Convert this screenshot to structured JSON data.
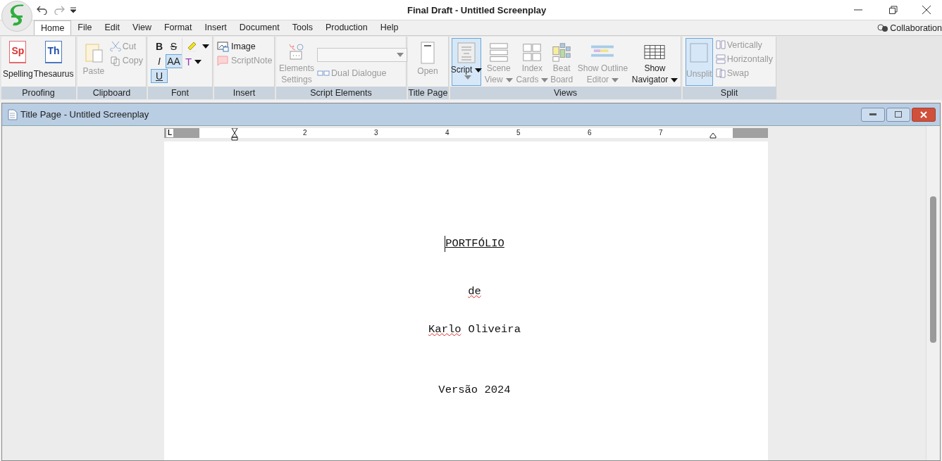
{
  "app": {
    "title": "Final Draft - Untitled Screenplay"
  },
  "menu": [
    {
      "label": "Home",
      "selected": true
    },
    {
      "label": "File",
      "selected": false
    },
    {
      "label": "Edit",
      "selected": false
    },
    {
      "label": "View",
      "selected": false
    },
    {
      "label": "Format",
      "selected": false
    },
    {
      "label": "Insert",
      "selected": false
    },
    {
      "label": "Document",
      "selected": false
    },
    {
      "label": "Tools",
      "selected": false
    },
    {
      "label": "Production",
      "selected": false
    },
    {
      "label": "Help",
      "selected": false
    }
  ],
  "collaboration": "Collaboration",
  "ribbon": [
    {
      "label": "Proofing",
      "items": [
        {
          "lines": [
            "Spelling"
          ],
          "badge": "Sp",
          "disabled": false
        },
        {
          "lines": [
            "Thesaurus"
          ],
          "badge": "Th",
          "disabled": false
        }
      ]
    },
    {
      "label": "Clipboard",
      "items": [
        {
          "lines": [
            "Paste"
          ],
          "disabled": true
        },
        {
          "lines": [
            "Cut"
          ],
          "disabled": true
        },
        {
          "lines": [
            "Copy"
          ],
          "disabled": true
        }
      ]
    },
    {
      "label": "Font",
      "items": [
        {
          "kind": "toggle",
          "label": "B",
          "selected": false
        },
        {
          "kind": "toggle",
          "label": "S",
          "selected": false
        },
        {
          "kind": "toggle",
          "label": "I",
          "selected": false
        },
        {
          "kind": "toggle",
          "label": "AA",
          "selected": true
        },
        {
          "kind": "toggle",
          "label": "U",
          "selected": true
        },
        {
          "kind": "highlight"
        },
        {
          "kind": "color",
          "label": "T"
        }
      ]
    },
    {
      "label": "Insert",
      "items": [
        {
          "lines": [
            "Image"
          ],
          "disabled": false
        },
        {
          "lines": [
            "ScriptNote"
          ],
          "disabled": true
        }
      ]
    },
    {
      "label": "Script Elements",
      "items": [
        {
          "lines": [
            "Elements",
            "Settings"
          ],
          "disabled": true
        },
        {
          "lines": [
            "Dual Dialogue"
          ],
          "disabled": true
        }
      ]
    },
    {
      "label": "Title Page",
      "items": [
        {
          "lines": [
            "Open"
          ],
          "disabled": true
        }
      ]
    },
    {
      "label": "Views",
      "items": [
        {
          "lines": [
            "Script"
          ],
          "dropdown": true,
          "selected": true,
          "disabled": false
        },
        {
          "lines": [
            "Scene",
            "View"
          ],
          "dropdown": true,
          "selected": false,
          "disabled": true
        },
        {
          "lines": [
            "Index",
            "Cards"
          ],
          "dropdown": true,
          "selected": false,
          "disabled": true
        },
        {
          "lines": [
            "Beat",
            "Board"
          ],
          "dropdown": false,
          "selected": false,
          "disabled": true
        },
        {
          "lines": [
            "Show Outline",
            "Editor"
          ],
          "dropdown": true,
          "selected": false,
          "disabled": true
        },
        {
          "lines": [
            "Show",
            "Navigator"
          ],
          "dropdown": true,
          "selected": false,
          "disabled": false
        }
      ]
    },
    {
      "label": "Split",
      "items": [
        {
          "lines": [
            "Unsplit"
          ],
          "selected": true,
          "disabled": true
        },
        {
          "lines": [
            "Vertically"
          ],
          "disabled": true
        },
        {
          "lines": [
            "Horizontally"
          ],
          "disabled": true
        },
        {
          "lines": [
            "Swap"
          ],
          "disabled": true
        }
      ]
    }
  ],
  "document": {
    "window_title": "Title Page - Untitled Screenplay",
    "ruler": {
      "tab": "L",
      "numbers": [
        "2",
        "3",
        "4",
        "5",
        "6",
        "7"
      ]
    },
    "lines": [
      {
        "underline": true,
        "words": [
          {
            "text": "PORTFÓLIO",
            "misspelled": false
          }
        ]
      },
      {
        "underline": false,
        "words": [
          {
            "text": "de",
            "misspelled": true
          }
        ]
      },
      {
        "underline": false,
        "words": [
          {
            "text": "Karlo",
            "misspelled": true
          },
          {
            "text": "Oliveira",
            "misspelled": false
          }
        ]
      },
      {
        "underline": false,
        "words": [
          {
            "text": "Versão 2024",
            "misspelled": false
          }
        ]
      }
    ]
  }
}
